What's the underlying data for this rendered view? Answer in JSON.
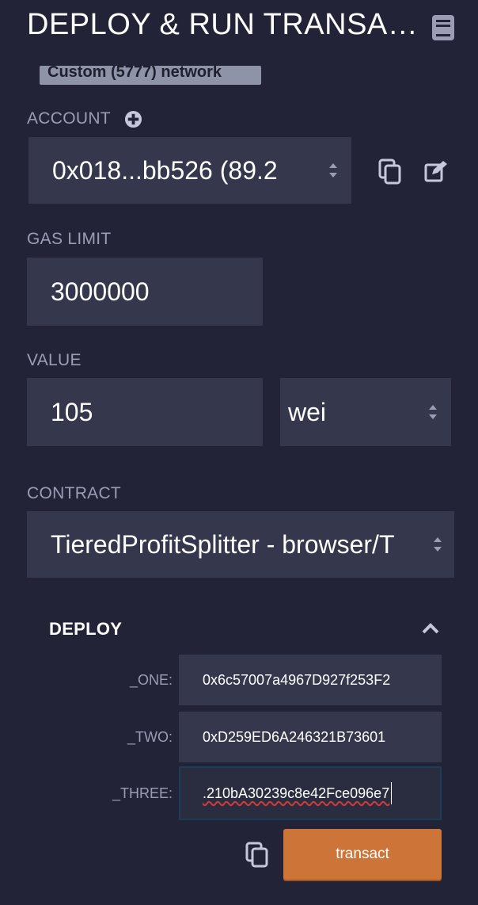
{
  "header": {
    "title": "DEPLOY & RUN TRANSA…",
    "docs_icon": "book-icon"
  },
  "environment": {
    "badge_text": "Custom (5777) network"
  },
  "account": {
    "label": "ACCOUNT",
    "add_icon": "plus-circle-icon",
    "selected": "0x018...bb526 (89.2",
    "copy_icon": "copy-icon",
    "edit_icon": "edit-icon"
  },
  "gas_limit": {
    "label": "GAS LIMIT",
    "value": "3000000"
  },
  "value": {
    "label": "VALUE",
    "amount": "105",
    "unit": "wei"
  },
  "contract": {
    "label": "CONTRACT",
    "selected": "TieredProfitSplitter - browser/T"
  },
  "deploy": {
    "label": "DEPLOY",
    "collapse_icon": "chevron-up-icon",
    "params": [
      {
        "label": "_ONE:",
        "value": "0x6c57007a4967D927f253F2"
      },
      {
        "label": "_TWO:",
        "value": "0xD259ED6A246321B73601"
      },
      {
        "label": "_THREE:",
        "value": ".210bA30239c8e42Fce096e7"
      }
    ],
    "copy_icon": "copy-icon",
    "transact_label": "transact"
  },
  "colors": {
    "background": "#222336",
    "input_background": "#35374c",
    "accent_orange": "#cd7439",
    "badge": "#8f93a8"
  }
}
